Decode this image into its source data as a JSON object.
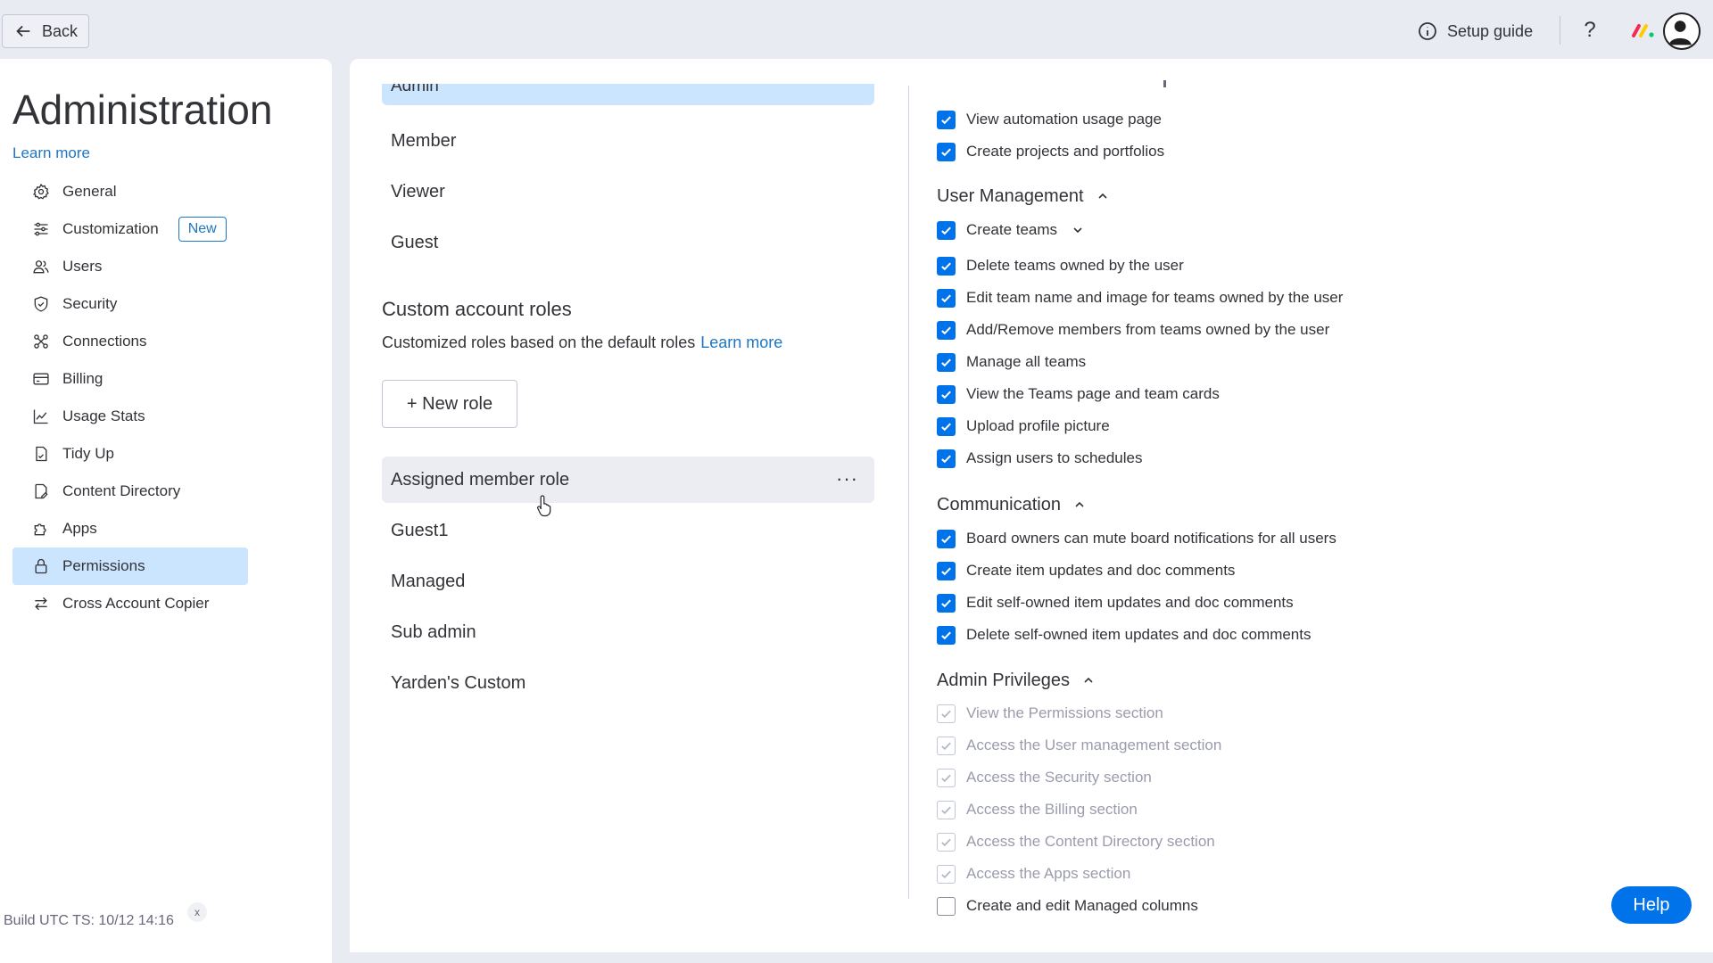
{
  "topbar": {
    "back_label": "Back",
    "setup_guide_label": "Setup guide",
    "help_symbol": "?"
  },
  "sidebar": {
    "title": "Administration",
    "learn_more": "Learn more",
    "items": [
      {
        "label": "General",
        "icon": "gear-icon"
      },
      {
        "label": "Customization",
        "icon": "sliders-icon",
        "badge": "New"
      },
      {
        "label": "Users",
        "icon": "users-icon"
      },
      {
        "label": "Security",
        "icon": "shield-icon"
      },
      {
        "label": "Connections",
        "icon": "connections-icon"
      },
      {
        "label": "Billing",
        "icon": "credit-card-icon"
      },
      {
        "label": "Usage Stats",
        "icon": "chart-line-icon"
      },
      {
        "label": "Tidy Up",
        "icon": "broom-icon"
      },
      {
        "label": "Content Directory",
        "icon": "content-directory-icon"
      },
      {
        "label": "Apps",
        "icon": "puzzle-icon"
      },
      {
        "label": "Permissions",
        "icon": "lock-icon",
        "active": true
      },
      {
        "label": "Cross Account Copier",
        "icon": "transfer-arrows-icon"
      }
    ],
    "build_text": "Build UTC TS: 10/12 14:16",
    "build_close": "x"
  },
  "roles": {
    "selected_partial": "Admin",
    "default_roles": [
      "Member",
      "Viewer",
      "Guest"
    ],
    "custom_title": "Custom account roles",
    "custom_subtitle": "Customized roles based on the default roles",
    "custom_learn_more": "Learn more",
    "new_role_label": "+ New role",
    "custom_roles": [
      "Assigned member role",
      "Guest1",
      "Managed",
      "Sub admin",
      "Yarden's Custom"
    ],
    "more_symbol": "···"
  },
  "permissions": {
    "top_items": [
      {
        "label": "View automation usage page",
        "state": "checked"
      },
      {
        "label": "Create projects and portfolios",
        "state": "checked"
      }
    ],
    "user_management": {
      "title": "User Management",
      "items": [
        {
          "label": "Create teams",
          "state": "checked",
          "expandable": true
        },
        {
          "label": "Delete teams owned by the user",
          "state": "checked"
        },
        {
          "label": "Edit team name and image for teams owned by the user",
          "state": "checked"
        },
        {
          "label": "Add/Remove members from teams owned by the user",
          "state": "checked"
        },
        {
          "label": "Manage all teams",
          "state": "checked"
        },
        {
          "label": "View the Teams page and team cards",
          "state": "checked"
        },
        {
          "label": "Upload profile picture",
          "state": "checked"
        },
        {
          "label": "Assign users to schedules",
          "state": "checked"
        }
      ]
    },
    "communication": {
      "title": "Communication",
      "items": [
        {
          "label": "Board owners can mute board notifications for all users",
          "state": "checked"
        },
        {
          "label": "Create item updates and doc comments",
          "state": "checked"
        },
        {
          "label": "Edit self-owned item updates and doc comments",
          "state": "checked"
        },
        {
          "label": "Delete self-owned item updates and doc comments",
          "state": "checked"
        }
      ]
    },
    "admin_privileges": {
      "title": "Admin Privileges",
      "items": [
        {
          "label": "View the Permissions section",
          "state": "disabled"
        },
        {
          "label": "Access the User management section",
          "state": "disabled"
        },
        {
          "label": "Access the Security section",
          "state": "disabled"
        },
        {
          "label": "Access the Billing section",
          "state": "disabled"
        },
        {
          "label": "Access the Content Directory section",
          "state": "disabled"
        },
        {
          "label": "Access the Apps section",
          "state": "disabled"
        },
        {
          "label": "Create and edit Managed columns",
          "state": "unchecked"
        }
      ]
    }
  },
  "help_button": "Help",
  "colors": {
    "accent": "#0073ea",
    "link": "#1f76c2",
    "selected_bg": "#cce5ff",
    "app_bg": "#e9ebf3"
  }
}
